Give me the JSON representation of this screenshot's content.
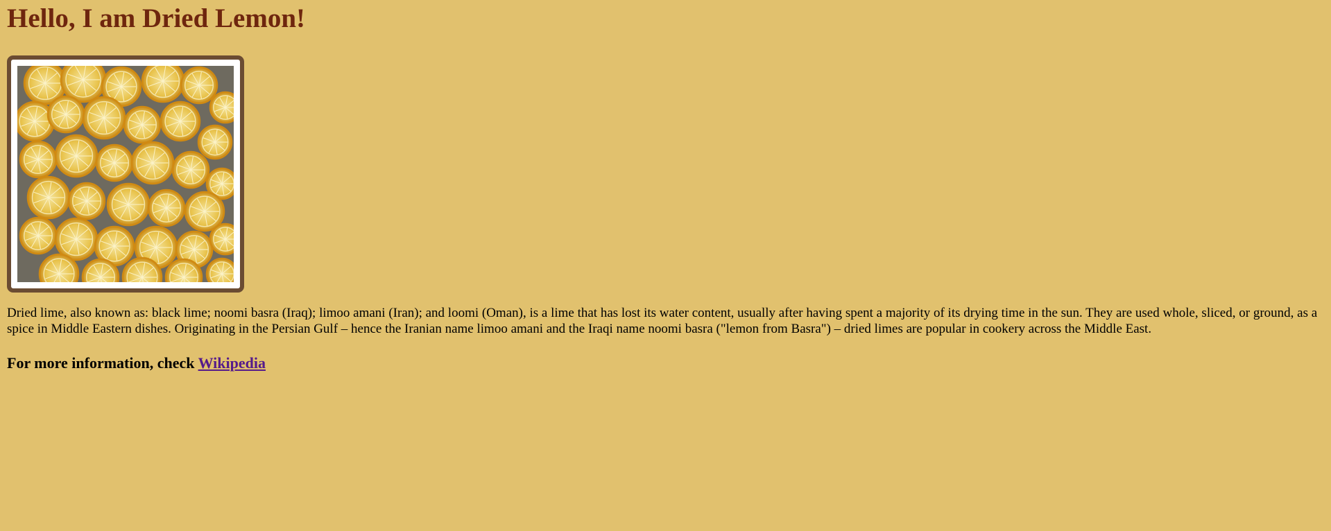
{
  "page": {
    "heading": "Hello, I am Dried Lemon!",
    "description": "Dried lime, also known as: black lime; noomi basra (Iraq); limoo amani (Iran); and loomi (Oman), is a lime that has lost its water content, usually after having spent a majority of its drying time in the sun. They are used whole, sliced, or ground, as a spice in Middle Eastern dishes. Originating in the Persian Gulf – hence the Iranian name limoo amani and the Iraqi name noomi basra (\"lemon from Basra\") – dried limes are popular in cookery across the Middle East.",
    "more_info_prefix": "For more information, check ",
    "link_label": "Wikipedia"
  },
  "colors": {
    "background": "#e1c16e",
    "heading": "#6e260e",
    "frame_border": "#6b4c32",
    "link_visited": "#551a8b"
  }
}
